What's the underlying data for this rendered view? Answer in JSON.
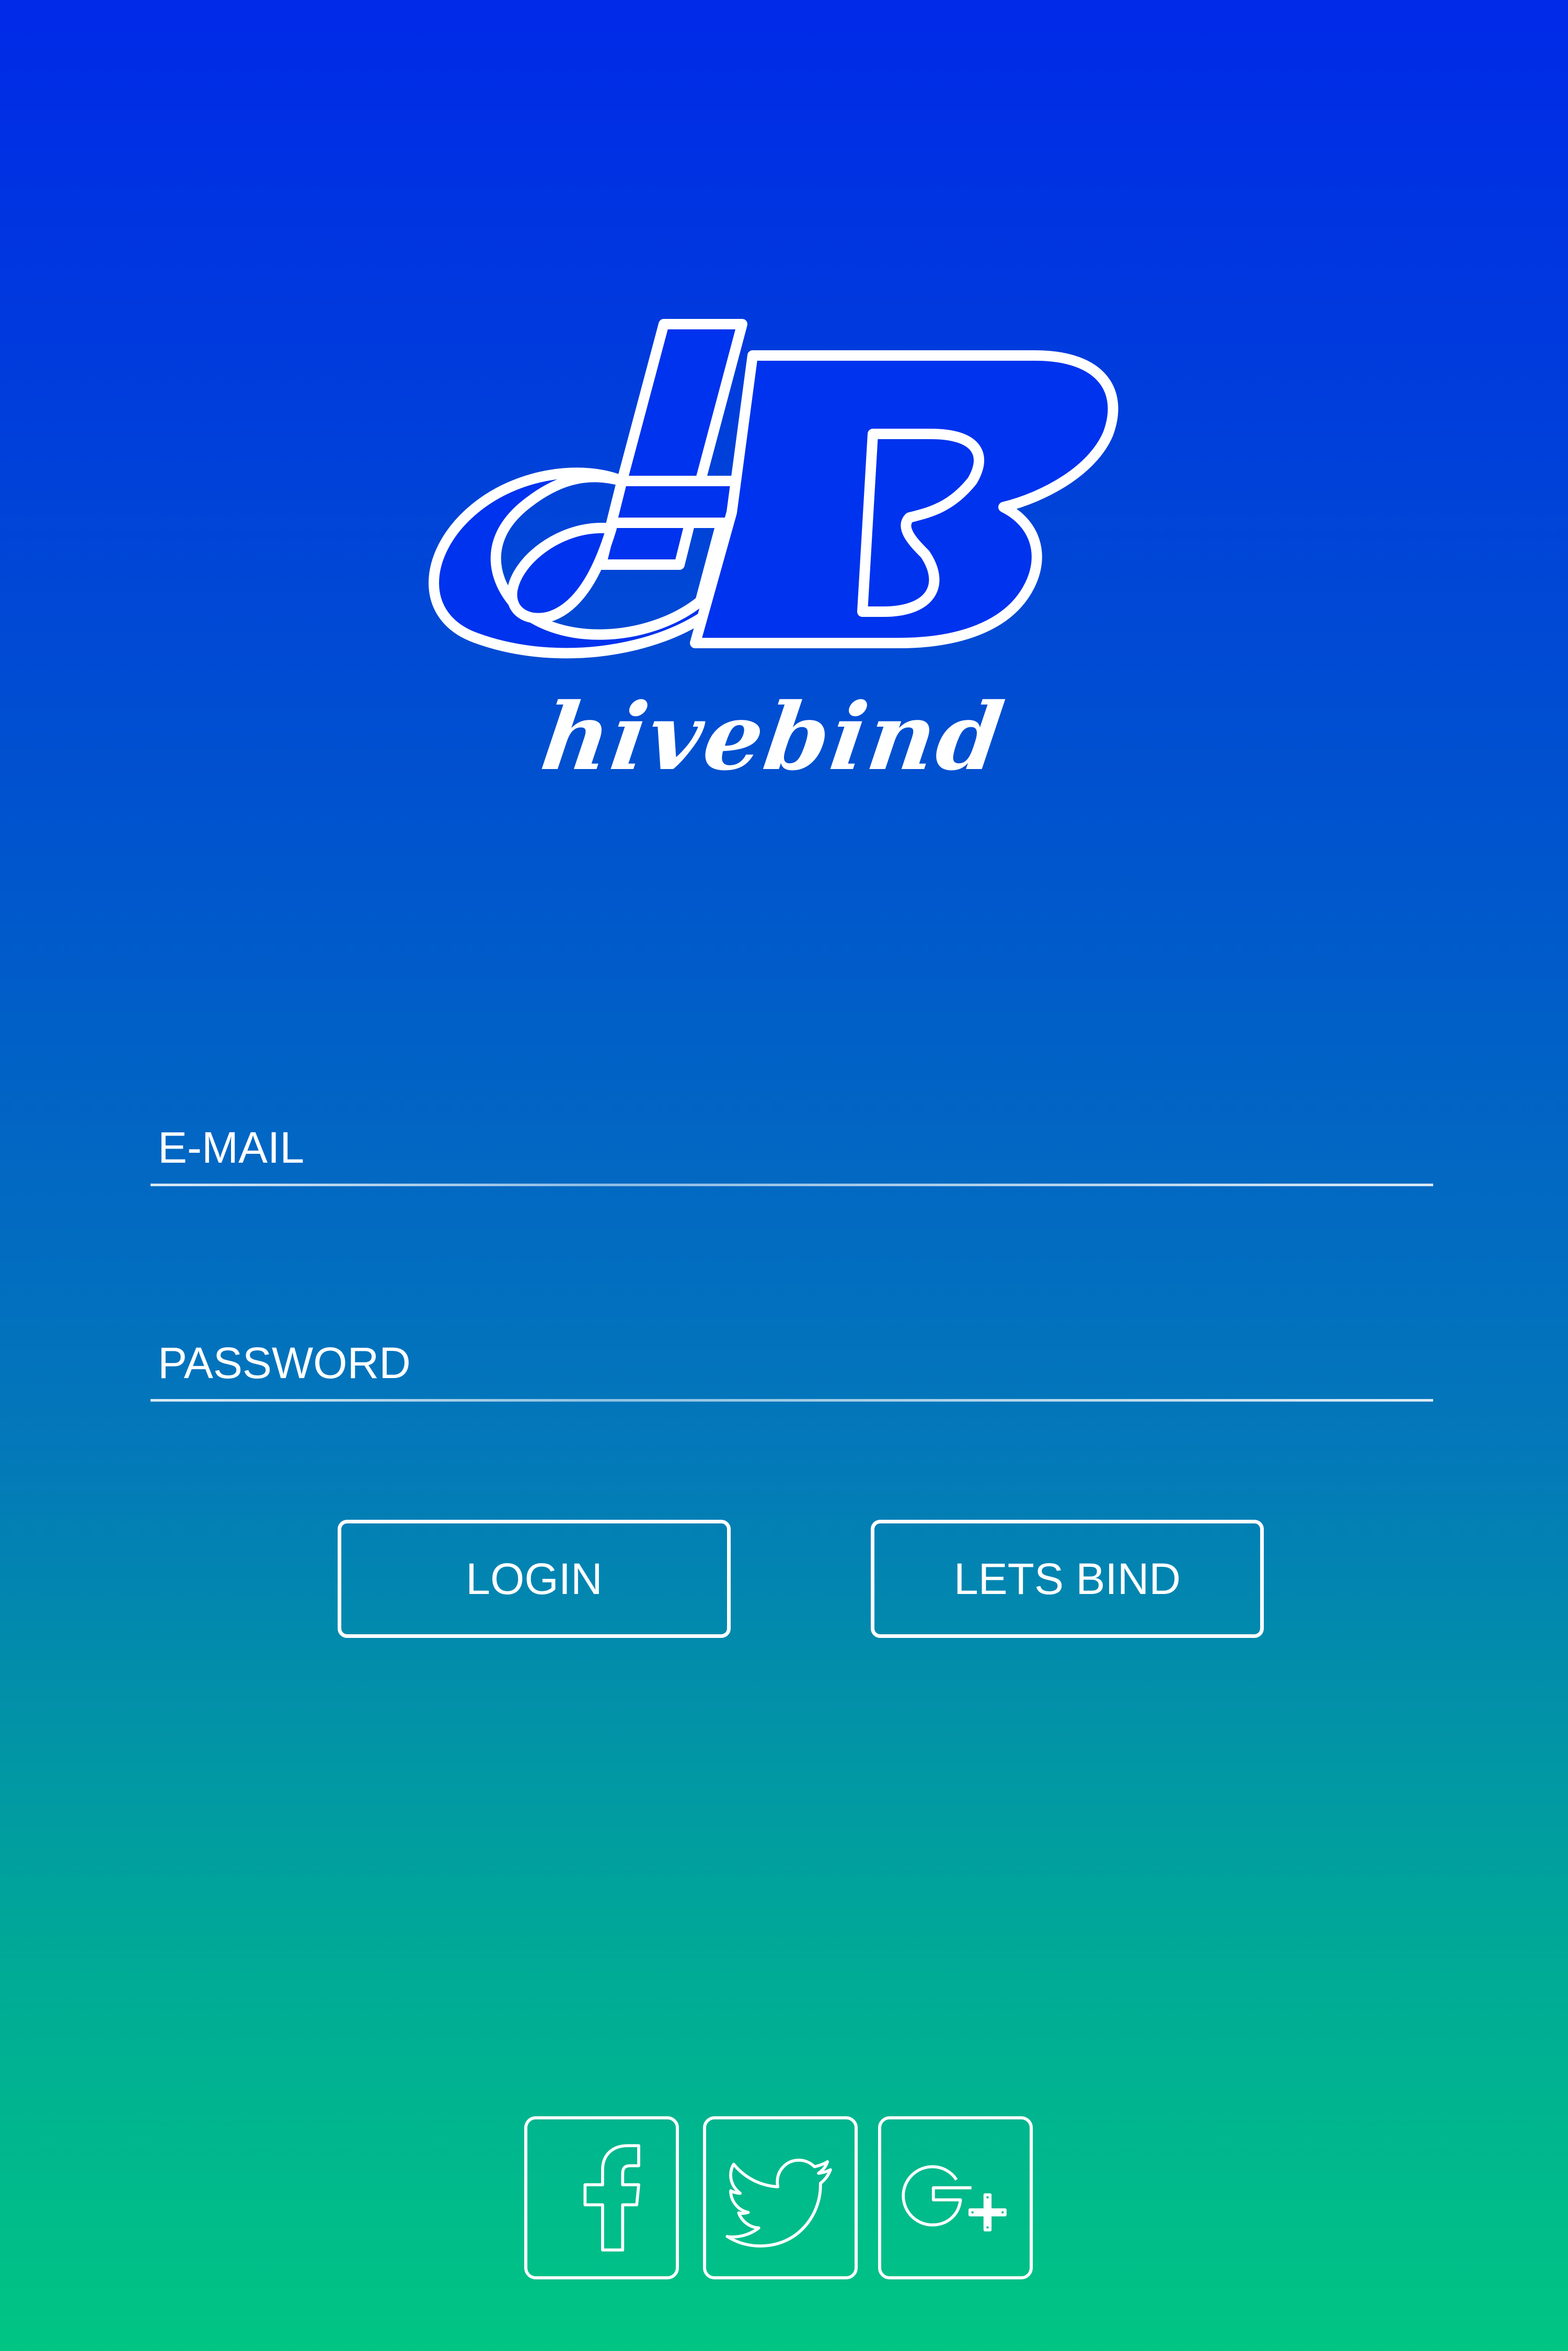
{
  "brand": {
    "logo_name": "hivebind",
    "logo_icon": "hb-monogram-icon"
  },
  "form": {
    "email_label": "E-MAIL",
    "password_label": "PASSWORD"
  },
  "actions": {
    "login_label": "LOGIN",
    "bind_label": "LETS BIND"
  },
  "social": [
    {
      "icon": "facebook-icon"
    },
    {
      "icon": "twitter-icon"
    },
    {
      "icon": "google-plus-icon"
    }
  ],
  "colors": {
    "gradient_top": "#0029e8",
    "gradient_bottom": "#00c583",
    "foreground": "#ffffff"
  }
}
